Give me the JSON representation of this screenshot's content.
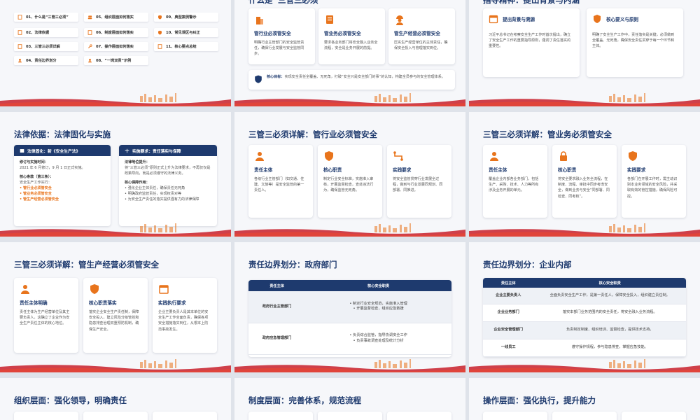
{
  "colors": {
    "navy": "#1e3a6e",
    "orange": "#e8741c",
    "red": "#c8202a"
  },
  "s1": {
    "toc": [
      "01、什么是“三管三必须”",
      "02、法律依据",
      "03、三管三必须详解",
      "04、责任边界划分",
      "05、组织层面如何落实",
      "06、制度层面如何落实",
      "07、操作层面如何落实",
      "08、“一岗双责”示例",
      "09、典型案例警示",
      "10、常见误区与纠正",
      "11、核心要点总结"
    ]
  },
  "s2": {
    "title_left": "什么是“三管三必须”",
    "cards": [
      {
        "head": "管行业必须管安全",
        "body": "明确行业主管部门的安全监管责任，确保行业发展与安全监管同步。"
      },
      {
        "head": "管业务必须管安全",
        "body": "要求各业务部门将安全融入业务全流程，安全是业务开展的前提。"
      },
      {
        "head": "管生产经营必须管安全",
        "body": "压实生产经营单位的主体责任，确保安全投入与管理落实到位。"
      }
    ],
    "goal_label": "核心目标：",
    "goal": "实现安全责任全覆盖、无死角，打破“安全只是安全部门的事”的认知，构建全员参与的安全管理体系。"
  },
  "s3": {
    "title_left": "指导精神：提出背景与内涵",
    "cards": [
      {
        "head": "提出背景与溯源",
        "body": "习近平总书记在考察安全生产工作时首次提出，确立了安全生产工作的重要指导原则，强调了责任落实的重要性。"
      },
      {
        "head": "核心要义与原则",
        "body": "明确了安全生产工作中，责任落实是关键，必须做到全覆盖、无死角，确保安全责任贯穿于每一个环节和主体。"
      }
    ]
  },
  "s4": {
    "title": "法律依据：法律固化与实施",
    "panel1": {
      "head": "法律固化：新《安全生产法》",
      "l1": "修订与实施时间：",
      "l2": "2021 年 6 月修订，9 月 1 日正式实施。",
      "l3": "核心条款（第三条）：",
      "l4": "安全生产工作实行：",
      "b1": "管行业必须管安全",
      "b2": "管业务必须管安全",
      "b3": "管生产经营必须管安全"
    },
    "panel2": {
      "head": "实施要求：责任落实与保障",
      "l1": "法律地位提升：",
      "l2": "将“三管三必须”原则正式上升为法律要求，不再仅仅是政策导向，而是必须遵守的法律义务。",
      "l3": "核心保障作用：",
      "i1": "强化企业主体责任，确保责任无死角",
      "i2": "明确政府监管责任，实现权责对等",
      "i3": "为安全生产责任的落实提供强有力的法律保障"
    }
  },
  "s5": {
    "title": "三管三必须详解：管行业必须管安全",
    "cards": [
      {
        "head": "责任主体",
        "body": "各级行业主管部门（如交通、住建、文旅等）是安全监管的第一责任人。"
      },
      {
        "head": "核心职责",
        "body": "制定行业安全标准，实施准入审核，开展监督检查，查处违法行为，确保监管无死角。"
      },
      {
        "head": "实践要求",
        "body": "将安全监管贯穿行业发展全过程，做到与行业发展同规划、同部署、同推进。"
      }
    ]
  },
  "s6": {
    "title": "三管三必须详解：管业务必须管安全",
    "cards": [
      {
        "head": "责任主体",
        "body": "覆盖企业内部各业务部门，包括生产、采购、技术、人力等所有涉及业务开展的单元。"
      },
      {
        "head": "核心职责",
        "body": "将安全要求融入业务全流程，在制度、流程、审批中同步考虑安全，做到业务与安全“同部署、同检查、同考核”。"
      },
      {
        "head": "实践要求",
        "body": "各部门在开展工作时，需主动识别本业务领域的安全风险，并采取有效的管控措施，确保风险可控。"
      }
    ]
  },
  "s7": {
    "title": "三管三必须详解：管生产经营必须管安全",
    "cards": [
      {
        "head": "责任主体明确",
        "body": "责任主体为生产经营单位及其主要负责人。这确立了企业作为安全生产责任主体的核心地位。"
      },
      {
        "head": "核心职责落实",
        "body": "落实企业安全生产责任制，保障安全投入，建立风险分级管控和隐患排查治理双重预防机制，确保生产安全。"
      },
      {
        "head": "实践执行要求",
        "body": "企业主要负责人是其本单位的安全生产工作全面负责，确保各项安全措施落实到位，从根本上防范事故发生。"
      }
    ]
  },
  "s8": {
    "title": "责任边界划分：政府部门",
    "th": [
      "责任主体",
      "核心安全职责"
    ],
    "rows": [
      {
        "subj": "政府行业主管部门",
        "items": [
          "• 制定行业安全规范，实施准入管理",
          "• 开展监督检查，组织应急救援"
        ]
      },
      {
        "subj": "政府应急管理部门",
        "items": [
          "• 负责综合监管，指导协调安全工作",
          "• 负责事故调查处理及统计分析"
        ]
      }
    ]
  },
  "s9": {
    "title": "责任边界划分：企业内部",
    "th": [
      "责任主体",
      "核心安全职责"
    ],
    "rows": [
      {
        "subj": "企业主要负责人",
        "duty": "全面负责安全生产工作，是第一责任人，保障安全投入，组织建立责任制。"
      },
      {
        "subj": "企业业务部门",
        "duty": "落实本部门业务范围内的安全责任，将安全融入业务流程。"
      },
      {
        "subj": "企业安全管理部门",
        "duty": "负责制定制度、组织培训、监督检查，提供技术支持。"
      },
      {
        "subj": "一线员工",
        "duty": "遵守操作规程，参与隐患排查，掌握应急技能。"
      }
    ]
  },
  "s10": {
    "title": "组织层面：强化领导，明确责任"
  },
  "s11": {
    "title": "制度层面：完善体系，规范流程"
  },
  "s12": {
    "title": "操作层面：强化执行，提升能力"
  }
}
